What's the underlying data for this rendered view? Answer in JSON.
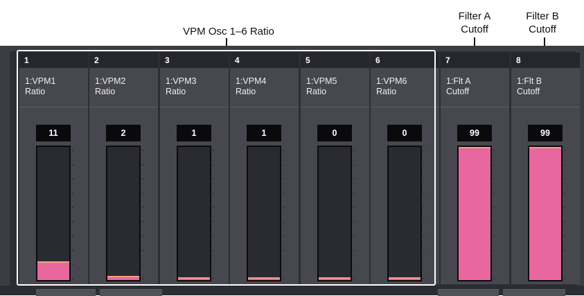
{
  "callouts": {
    "vpm_group": "VPM Osc 1–6 Ratio",
    "filter_a": [
      "Filter A",
      "Cutoff"
    ],
    "filter_b": [
      "Filter B",
      "Cutoff"
    ]
  },
  "colors": {
    "bar_fill": "#e8679e",
    "bar_fill_top": "#f2a07b",
    "panel": "#3c3d44",
    "group_outline": "#ffffff"
  },
  "columns": [
    {
      "number": "1",
      "name_line1": "1:VPM1",
      "name_line2": "Ratio",
      "value": "11",
      "level": 0.14
    },
    {
      "number": "2",
      "name_line1": "1:VPM2",
      "name_line2": "Ratio",
      "value": "2",
      "level": 0.03
    },
    {
      "number": "3",
      "name_line1": "1:VPM3",
      "name_line2": "Ratio",
      "value": "1",
      "level": 0.02
    },
    {
      "number": "4",
      "name_line1": "1:VPM4",
      "name_line2": "Ratio",
      "value": "1",
      "level": 0.02
    },
    {
      "number": "5",
      "name_line1": "1:VPM5",
      "name_line2": "Ratio",
      "value": "0",
      "level": 0.01
    },
    {
      "number": "6",
      "name_line1": "1:VPM6",
      "name_line2": "Ratio",
      "value": "0",
      "level": 0.01
    },
    {
      "number": "7",
      "name_line1": "1:Flt A",
      "name_line2": "Cutoff",
      "value": "99",
      "level": 1.0
    },
    {
      "number": "8",
      "name_line1": "1:Flt B",
      "name_line2": "Cutoff",
      "value": "99",
      "level": 1.0
    }
  ]
}
